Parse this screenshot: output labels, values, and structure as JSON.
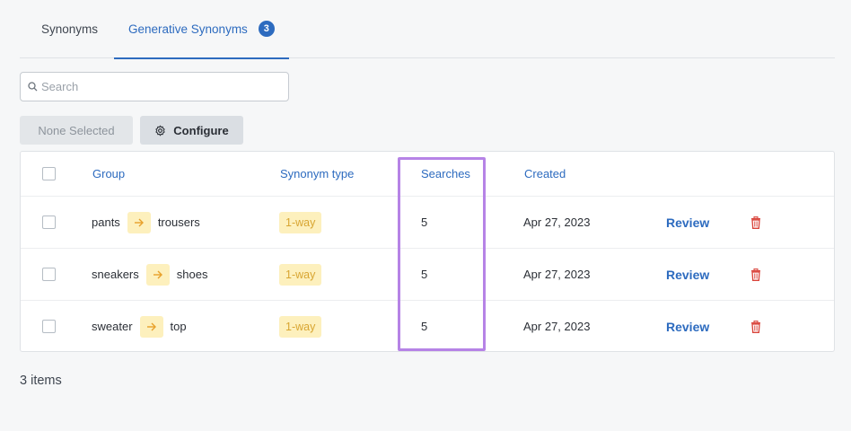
{
  "tabs": {
    "synonyms_label": "Synonyms",
    "generative_label": "Generative Synonyms",
    "generative_count": "3"
  },
  "search": {
    "placeholder": "Search",
    "value": ""
  },
  "toolbar": {
    "none_selected_label": "None Selected",
    "configure_label": "Configure"
  },
  "table": {
    "headers": {
      "group": "Group",
      "synonym_type": "Synonym type",
      "searches": "Searches",
      "created": "Created"
    },
    "rows": [
      {
        "from": "pants",
        "to": "trousers",
        "type": "1-way",
        "searches": "5",
        "created": "Apr 27, 2023",
        "action": "Review"
      },
      {
        "from": "sneakers",
        "to": "shoes",
        "type": "1-way",
        "searches": "5",
        "created": "Apr 27, 2023",
        "action": "Review"
      },
      {
        "from": "sweater",
        "to": "top",
        "type": "1-way",
        "searches": "5",
        "created": "Apr 27, 2023",
        "action": "Review"
      }
    ]
  },
  "footer": {
    "items_count": "3 items"
  },
  "colors": {
    "accent": "#2d6bbf",
    "highlight": "#b683e6",
    "tag_bg": "#fdf0bd",
    "delete": "#d9433a"
  }
}
